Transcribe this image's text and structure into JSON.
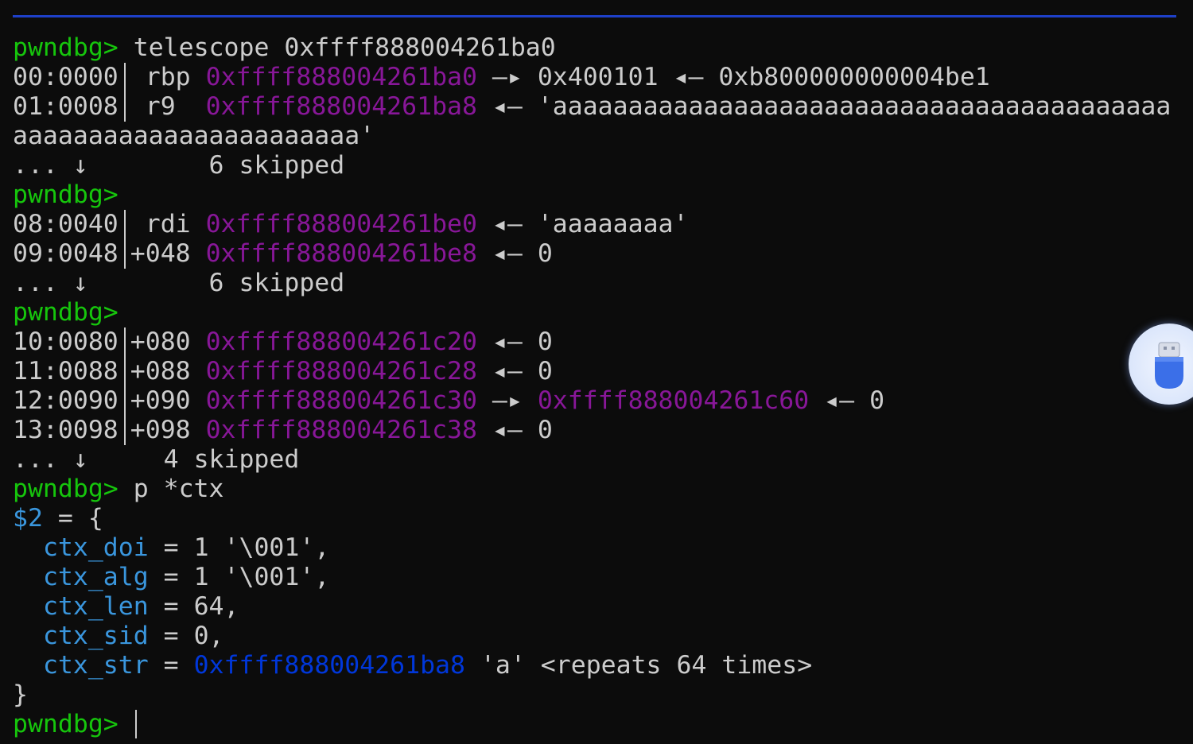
{
  "colors": {
    "background": "#0c0c0c",
    "prompt": "#16c60c",
    "text": "#cccccc",
    "address": "#881798",
    "field": "#3a96dd",
    "pointer": "#0037da",
    "rule": "#1e40c8"
  },
  "prompt": "pwndbg>",
  "telescope_command": " telescope 0xffff888004261ba0",
  "rows": {
    "r0": {
      "idx": "00:0000",
      "reg": " rbp ",
      "addr": "0xffff888004261ba0",
      "arrow": " —▸ ",
      "val": "0x400101",
      "arrow2": " ◂— ",
      "val2": "0xb800000000004be1"
    },
    "r1": {
      "idx": "01:0008",
      "reg": " r9  ",
      "addr": "0xffff888004261ba8",
      "arrow": " ◂— ",
      "val": "'aaaaaaaaaaaaaaaaaaaaaaaaaaaaaaaaaaaaaaaaa"
    },
    "r1_wrap": "aaaaaaaaaaaaaaaaaaaaaaa'",
    "skip1": "... ↓        6 skipped",
    "r8": {
      "idx": "08:0040",
      "reg": " rdi ",
      "addr": "0xffff888004261be0",
      "arrow": " ◂— ",
      "val": "'aaaaaaaa'"
    },
    "r9": {
      "idx": "09:0048",
      "reg": "+048 ",
      "addr": "0xffff888004261be8",
      "arrow": " ◂— ",
      "val": "0"
    },
    "skip2": "... ↓        6 skipped",
    "r10": {
      "idx": "10:0080",
      "reg": "+080 ",
      "addr": "0xffff888004261c20",
      "arrow": " ◂— ",
      "val": "0"
    },
    "r11": {
      "idx": "11:0088",
      "reg": "+088 ",
      "addr": "0xffff888004261c28",
      "arrow": " ◂— ",
      "val": "0"
    },
    "r12": {
      "idx": "12:0090",
      "reg": "+090 ",
      "addr": "0xffff888004261c30",
      "arrow": " —▸ ",
      "addr2": "0xffff888004261c60",
      "arrow2": " ◂— ",
      "val": "0"
    },
    "r13": {
      "idx": "13:0098",
      "reg": "+098 ",
      "addr": "0xffff888004261c38",
      "arrow": " ◂— ",
      "val": "0"
    },
    "skip3": "... ↓     4 skipped"
  },
  "print_command": " p *ctx",
  "result": {
    "var": "$2",
    "open": " = {",
    "fields": [
      {
        "name": "ctx_doi",
        "value": " = 1 '\\001',"
      },
      {
        "name": "ctx_alg",
        "value": " = 1 '\\001',"
      },
      {
        "name": "ctx_len",
        "value": " = 64,"
      },
      {
        "name": "ctx_sid",
        "value": " = 0,"
      },
      {
        "name": "ctx_str",
        "eq": " = ",
        "ptr": "0xffff888004261ba8",
        "value": " 'a' <repeats 64 times>"
      }
    ],
    "close": "}"
  },
  "tray_icon": "usb-drive-icon"
}
